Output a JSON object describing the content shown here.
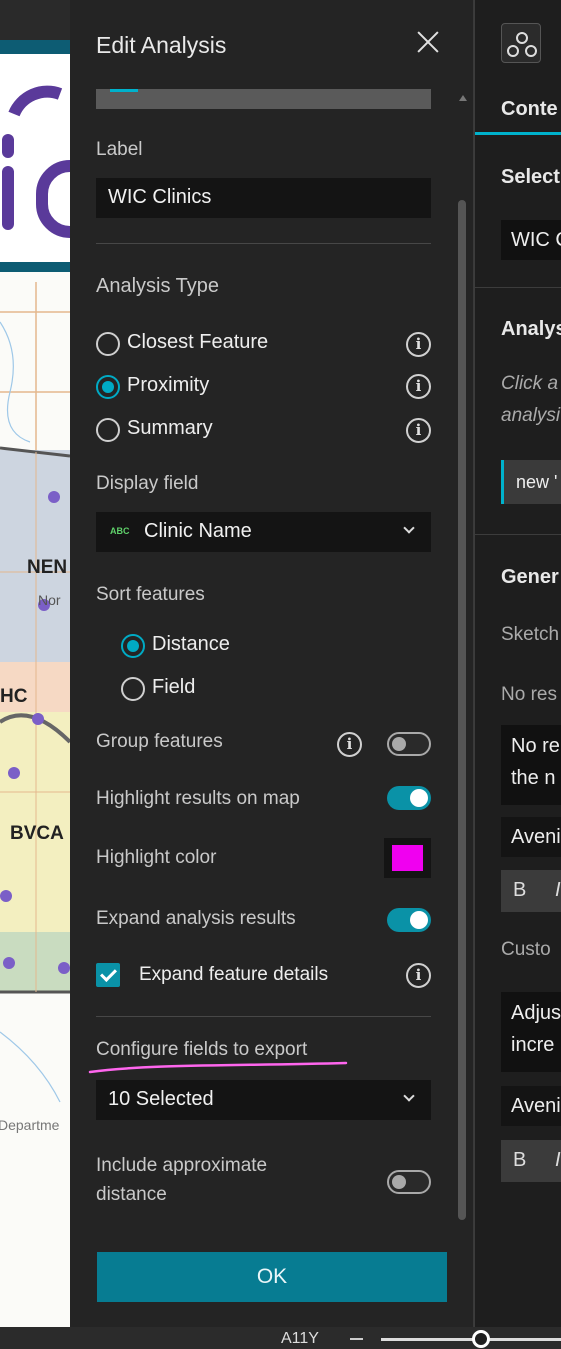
{
  "map": {
    "region_labels": [
      "NEN",
      "Nor",
      "HC",
      "BVCA"
    ],
    "attribution": "Departme",
    "colors": {
      "banner_frame": "#0d5c73",
      "logo_purple": "#5a3a9a",
      "dot": "#7b5fc7"
    }
  },
  "panel": {
    "title": "Edit Analysis",
    "label_heading": "Label",
    "label_value": "WIC Clinics",
    "analysis_type_heading": "Analysis Type",
    "analysis_types": [
      {
        "label": "Closest Feature",
        "selected": false
      },
      {
        "label": "Proximity",
        "selected": true
      },
      {
        "label": "Summary",
        "selected": false
      }
    ],
    "display_field_heading": "Display field",
    "display_field_type_badge": "ABC",
    "display_field_value": "Clinic Name",
    "sort_heading": "Sort features",
    "sort_options": [
      {
        "label": "Distance",
        "selected": true
      },
      {
        "label": "Field",
        "selected": false
      }
    ],
    "group_features_label": "Group features",
    "group_features_on": false,
    "highlight_results_label": "Highlight results on map",
    "highlight_results_on": true,
    "highlight_color_label": "Highlight color",
    "highlight_color": "#f000f0",
    "expand_results_label": "Expand analysis results",
    "expand_results_on": true,
    "expand_details_label": "Expand feature details",
    "expand_details_checked": true,
    "export_fields_label": "Configure fields to export",
    "export_fields_value": "10 Selected",
    "approx_distance_label_line1": "Include approximate",
    "approx_distance_label_line2": "distance",
    "approx_distance_on": false,
    "ok_label": "OK",
    "accent_color": "#00aac4",
    "annotation_color": "#ff66ee"
  },
  "right_panel": {
    "tab_label": "Conte",
    "select_heading": "Select",
    "select_value": "WIC C",
    "analysis_heading": "Analys",
    "hint_line1": "Click a",
    "hint_line2": "analysi",
    "new_chip": "new '",
    "general_heading": "Gener",
    "sketch_label": "Sketch",
    "no_results_label": "No res",
    "no_results_text_line1": "No re",
    "no_results_text_line2": "the n",
    "font_name_1": "Aveni",
    "bold_button_1": "B",
    "italic_button_1": "I",
    "custom_label": "Custo",
    "custom_text_line1": "Adjus",
    "custom_text_line2": "incre",
    "font_name_2": "Aveni",
    "bold_button_2": "B",
    "italic_button_2": "I"
  },
  "status_bar": {
    "a11y_label": "A11Y"
  }
}
